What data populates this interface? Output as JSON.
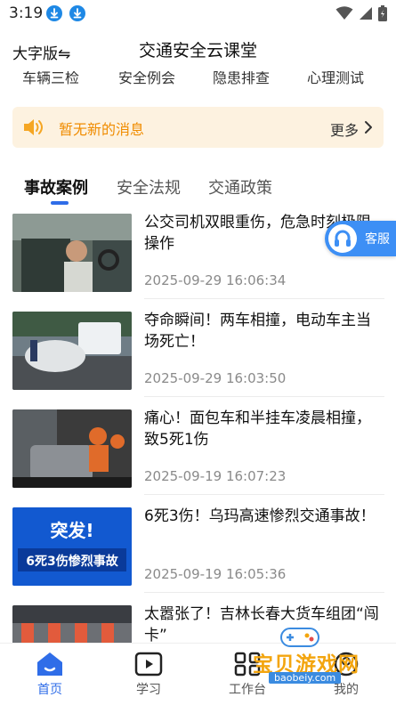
{
  "status_bar": {
    "time": "3:19",
    "icons": [
      "download-icon",
      "download-icon",
      "wifi-icon",
      "signal-icon",
      "battery-icon"
    ]
  },
  "header": {
    "font_toggle": "大字版⇋",
    "title": "交通安全云课堂"
  },
  "categories": [
    "车辆三检",
    "安全例会",
    "隐患排查",
    "心理测试"
  ],
  "notice": {
    "text": "暂无新的消息",
    "more": "更多"
  },
  "tabs": [
    {
      "label": "事故案例",
      "active": true
    },
    {
      "label": "安全法规",
      "active": false
    },
    {
      "label": "交通政策",
      "active": false
    }
  ],
  "news": [
    {
      "title": "公交司机双眼重伤，危急时刻极限操作",
      "time": "2025-09-29 16:06:34"
    },
    {
      "title": "夺命瞬间！两车相撞，电动车主当场死亡！",
      "time": "2025-09-29 16:03:50"
    },
    {
      "title": "痛心！面包车和半挂车凌晨相撞，致5死1伤",
      "time": "2025-09-19 16:07:23"
    },
    {
      "title": "6死3伤！乌玛高速惨烈交通事故！",
      "time": "2025-09-19 16:05:36",
      "thumb_text": {
        "line1": "突发!",
        "line2": "6死3伤惨烈事故"
      }
    },
    {
      "title": "太嚣张了！吉林长春大货车组团“闯卡”",
      "time": ""
    }
  ],
  "service": {
    "label": "客服"
  },
  "bottom_nav": [
    {
      "label": "首页",
      "icon": "home-icon",
      "active": true
    },
    {
      "label": "学习",
      "icon": "play-icon",
      "active": false
    },
    {
      "label": "工作台",
      "icon": "grid-icon",
      "active": false
    },
    {
      "label": "我的",
      "icon": "user-icon",
      "active": false
    }
  ],
  "watermark": {
    "text": "宝贝游戏网",
    "url": "baobeiy.com"
  },
  "colors": {
    "accent": "#2f6de8",
    "notice_bg": "#fdf2e0",
    "notice_text": "#f08c00",
    "service": "#3d8ff5"
  }
}
